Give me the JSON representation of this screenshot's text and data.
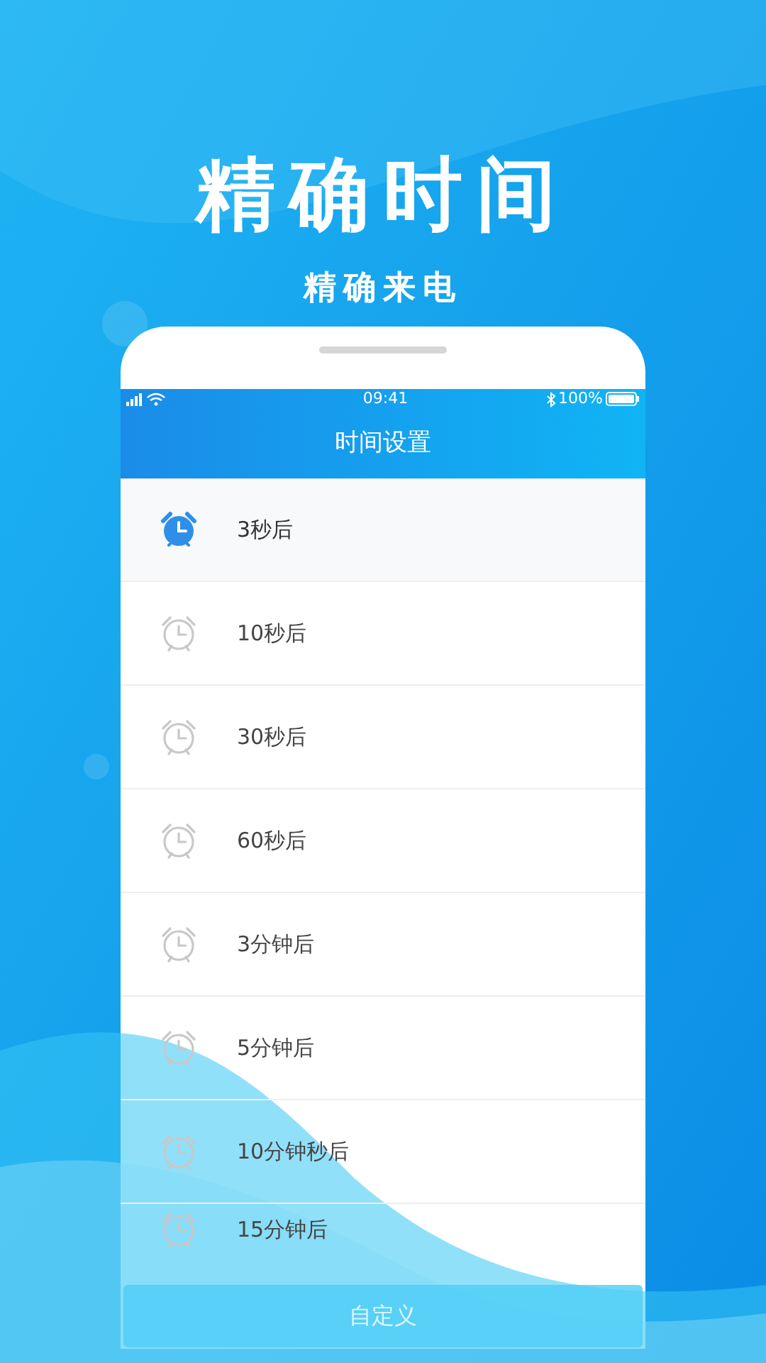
{
  "headline": "精确时间",
  "subheadline": "精确来电",
  "status_bar": {
    "time": "09:41",
    "battery": "100%"
  },
  "nav_title": "时间设置",
  "items": [
    {
      "label": "3秒后",
      "selected": true
    },
    {
      "label": "10秒后",
      "selected": false
    },
    {
      "label": "30秒后",
      "selected": false
    },
    {
      "label": "60秒后",
      "selected": false
    },
    {
      "label": "3分钟后",
      "selected": false
    },
    {
      "label": "5分钟后",
      "selected": false
    },
    {
      "label": "10分钟秒后",
      "selected": false
    },
    {
      "label": "15分钟后",
      "selected": false
    }
  ],
  "custom_button": "自定义"
}
